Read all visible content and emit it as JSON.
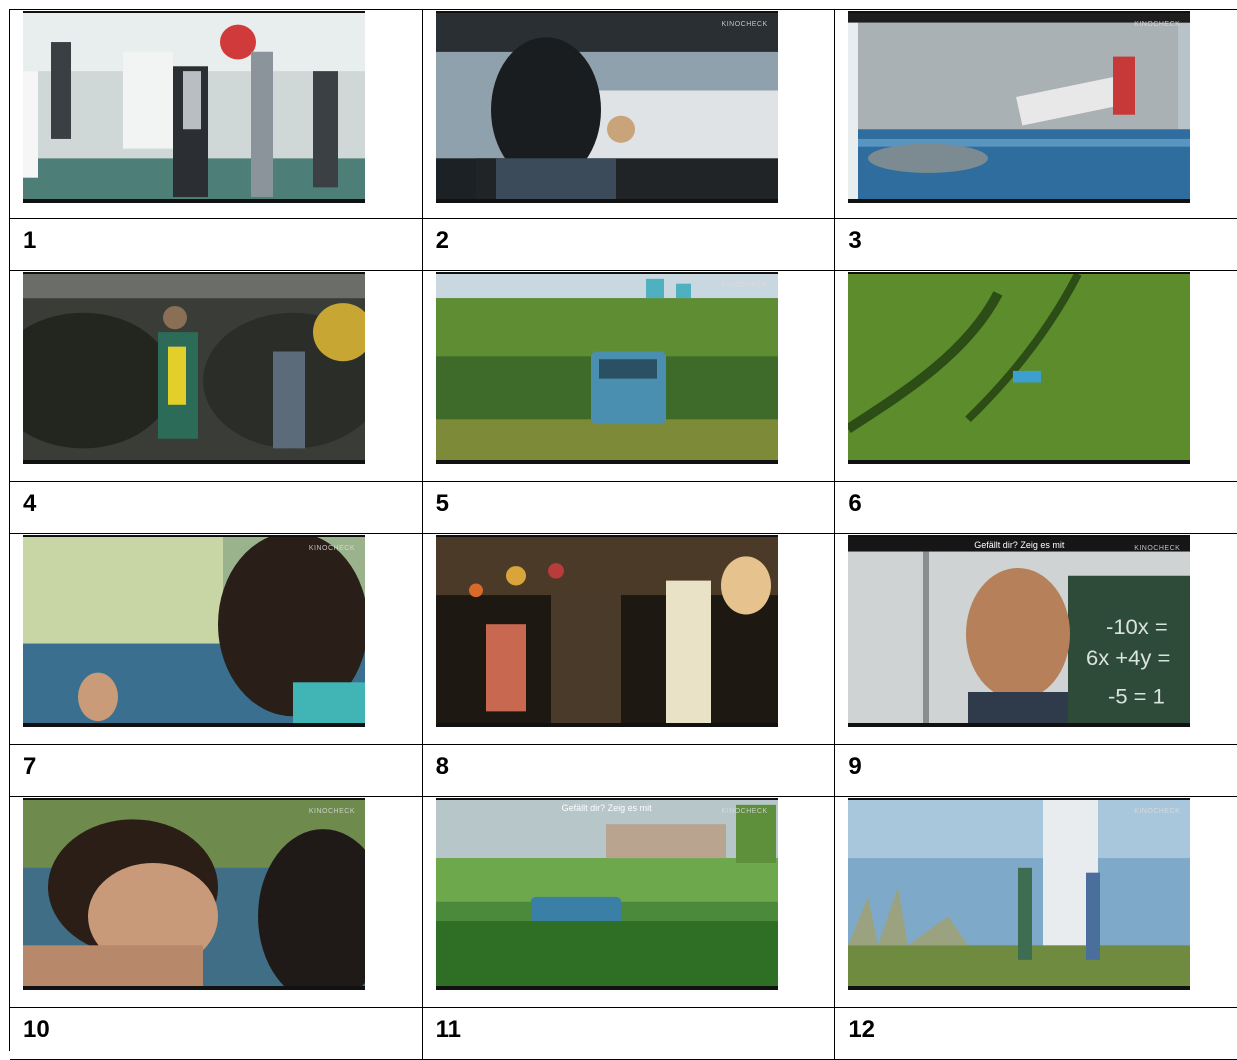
{
  "stills": [
    {
      "number": "1",
      "scene": "school-corridor"
    },
    {
      "number": "2",
      "scene": "car-window"
    },
    {
      "number": "3",
      "scene": "pool-house"
    },
    {
      "number": "4",
      "scene": "junkyard"
    },
    {
      "number": "5",
      "scene": "car-in-cornfield"
    },
    {
      "number": "6",
      "scene": "aerial-cornfield"
    },
    {
      "number": "7",
      "scene": "girl-in-car"
    },
    {
      "number": "8",
      "scene": "party"
    },
    {
      "number": "9",
      "scene": "classroom-blackboard"
    },
    {
      "number": "10",
      "scene": "lake-close-up"
    },
    {
      "number": "11",
      "scene": "park-car"
    },
    {
      "number": "12",
      "scene": "water-tower"
    }
  ],
  "watermark": "KINOCHECK",
  "overlay_text_9": "Gefällt dir? Zeig es mit",
  "overlay_text_11": "Gefällt dir? Zeig es mit",
  "blackboard_text": [
    "-10x =",
    "6x +4y =",
    "-5 = 1"
  ]
}
